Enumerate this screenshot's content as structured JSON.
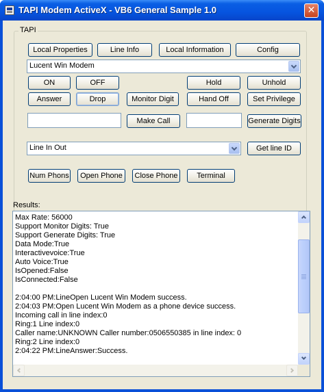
{
  "window": {
    "title": "TAPI Modem ActiveX - VB6 General Sample 1.0",
    "close_glyph": "✕"
  },
  "tapi": {
    "group_label": "TAPI",
    "buttons": {
      "local_properties": "Local Properties",
      "line_info": "Line Info",
      "local_information": "Local Information",
      "config": "Config",
      "on": "ON",
      "off": "OFF",
      "hold": "Hold",
      "unhold": "Unhold",
      "answer": "Answer",
      "drop": "Drop",
      "monitor_digit": "Monitor Digit",
      "hand_off": "Hand Off",
      "set_privilege": "Set Privilege",
      "make_call": "Make Call",
      "generate_digits": "Generate Digits",
      "get_line_id": "Get line ID",
      "num_phons": "Num Phons",
      "open_phone": "Open Phone",
      "close_phone": "Close Phone",
      "terminal": "Terminal"
    },
    "modem_select": {
      "value": "Lucent Win Modem"
    },
    "line_select": {
      "value": "Line In Out"
    },
    "call_number_input": {
      "value": ""
    },
    "digits_input": {
      "value": ""
    }
  },
  "results": {
    "label": "Results:",
    "lines": [
      "Max Rate: 56000",
      "Support Monitor Digits: True",
      "Support Generate Digits: True",
      "Data Mode:True",
      "Interactivevoice:True",
      "Auto Voice:True",
      "IsOpened:False",
      "IsConnected:False",
      "",
      "2:04:00 PM:LineOpen Lucent Win Modem success.",
      "2:04:03 PM:Open Lucent Win Modem as a phone device success.",
      "Incoming call in line index:0",
      "Ring:1  Line index:0",
      "Caller name:UNKNOWN Caller number:0506550385 in line index: 0",
      "Ring:2  Line index:0",
      "2:04:22 PM:LineAnswer:Success."
    ]
  },
  "colors": {
    "titlebar": "#0654df",
    "dialog_face": "#ece9d8",
    "button_border": "#003c74"
  },
  "icons": [
    "app-icon",
    "close-icon",
    "dropdown-arrow-icon",
    "scroll-up-icon",
    "scroll-down-icon",
    "scroll-left-icon",
    "scroll-right-icon"
  ]
}
